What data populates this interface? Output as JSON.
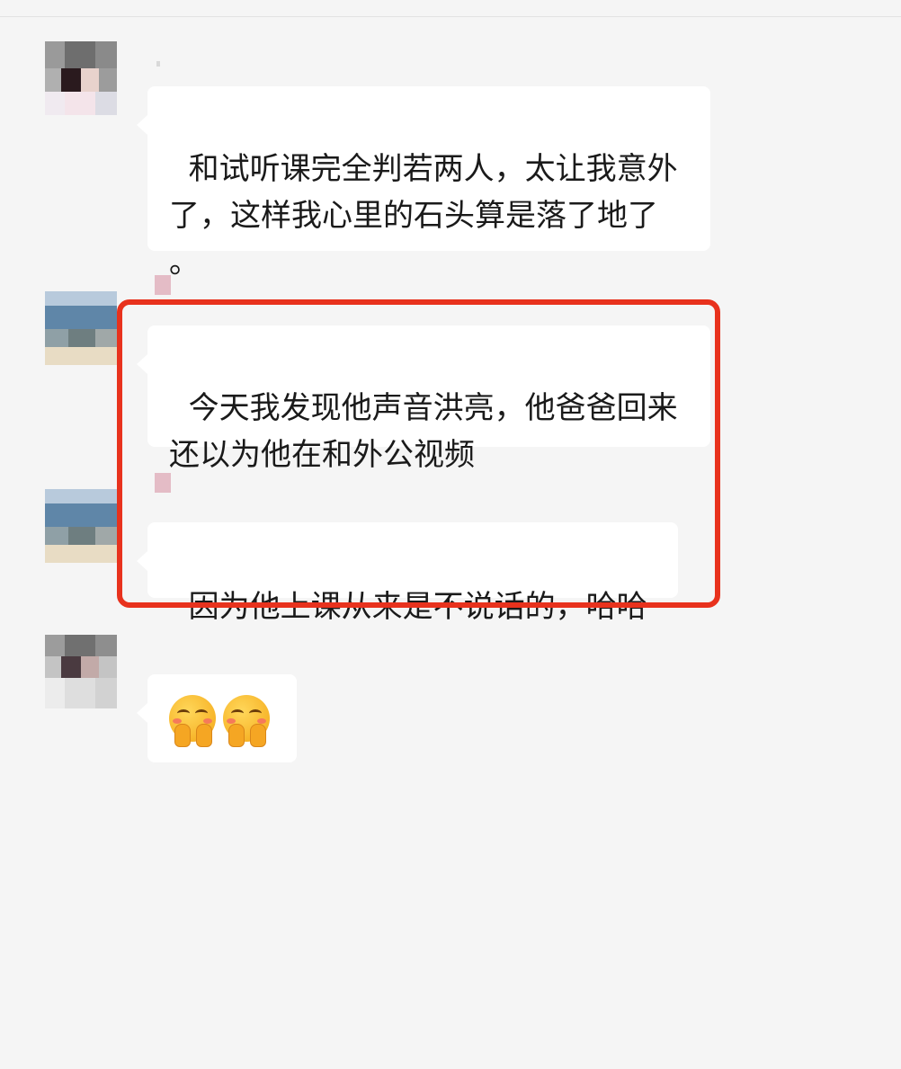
{
  "messages": [
    {
      "id": "msg1",
      "text": "和试听课完全判若两人，太让我意外\n了，这样我心里的石头算是落了地了\n。"
    },
    {
      "id": "msg2",
      "text": "今天我发现他声音洪亮，他爸爸回来\n还以为他在和外公视频"
    },
    {
      "id": "msg3",
      "text": "因为他上课从来是不说话的，哈哈"
    },
    {
      "id": "msg4",
      "emoji": [
        "hugging-face-emoji",
        "hugging-face-emoji"
      ]
    }
  ],
  "highlight_color": "#e8321d",
  "bubble_color": "#ffffff",
  "background_color": "#f5f5f5"
}
